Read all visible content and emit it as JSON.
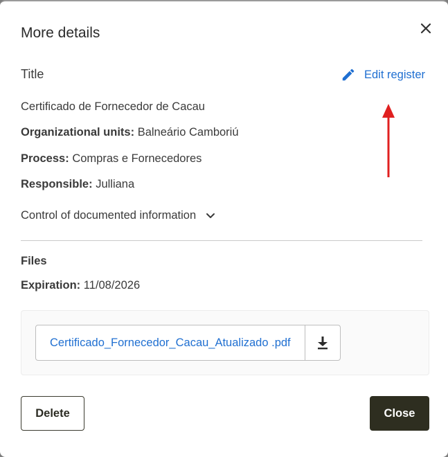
{
  "modal": {
    "title": "More details",
    "close_icon": "close-icon"
  },
  "record": {
    "section_title": "Title",
    "edit_label": "Edit register",
    "edit_icon": "pencil-icon",
    "name": "Certificado de Fornecedor de Cacau",
    "org_units_label": "Organizational units:",
    "org_units_value": "Balneário Camboriú",
    "process_label": "Process:",
    "process_value": "Compras e Fornecedores",
    "responsible_label": "Responsible:",
    "responsible_value": "Julliana",
    "control_label": "Control of documented information",
    "control_icon": "chevron-down-icon"
  },
  "annotation": {
    "arrow_color": "#e02020",
    "arrow_icon": "arrow-up-icon"
  },
  "files": {
    "label": "Files",
    "expiration_label": "Expiration:",
    "expiration_value": "11/08/2026",
    "items": [
      {
        "name": "Certificado_Fornecedor_Cacau_Atualizado .pdf",
        "download_icon": "download-icon"
      }
    ]
  },
  "footer": {
    "delete_label": "Delete",
    "close_label": "Close"
  },
  "colors": {
    "link": "#1f6fd1",
    "primary_button": "#2e2e20",
    "text": "#3a3a3a"
  }
}
